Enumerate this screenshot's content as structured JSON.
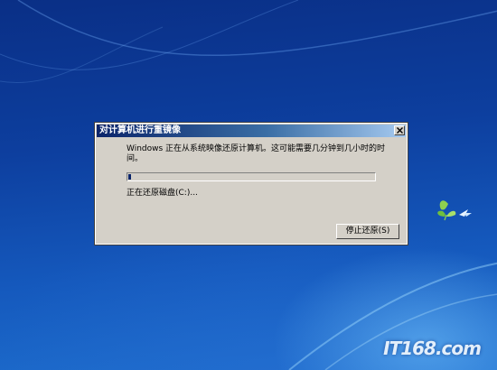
{
  "dialog": {
    "title": "对计算机进行重镜像",
    "message": "Windows 正在从系统映像还原计算机。这可能需要几分钟到几小时的时间。",
    "progress_fraction": 0.01,
    "status": "正在还原磁盘(C:)...",
    "stop_button_label": "停止还原(S)"
  },
  "branding": {
    "logo_text": "IT168.com"
  },
  "colors": {
    "accent": "#0a246a",
    "dialog_bg": "#d4d0c8"
  },
  "icons": [
    "close-icon",
    "windows-logo-watermark"
  ]
}
